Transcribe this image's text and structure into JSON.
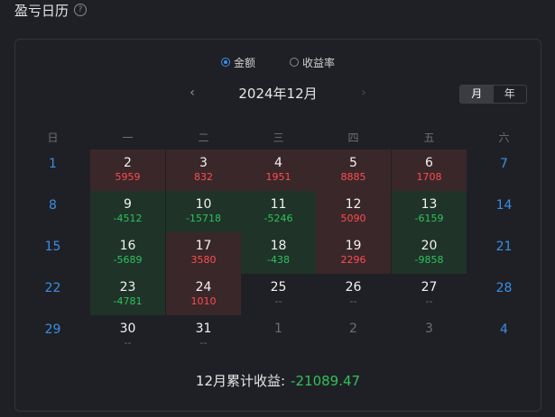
{
  "header": {
    "title": "盈亏日历",
    "help": "?"
  },
  "radio": [
    {
      "label": "金额",
      "selected": true
    },
    {
      "label": "收益率",
      "selected": false
    }
  ],
  "nav": {
    "prev": "‹",
    "month": "2024年12月",
    "next": "›"
  },
  "toggle": {
    "month": "月",
    "year": "年",
    "active": "月"
  },
  "weekdays": [
    "日",
    "一",
    "二",
    "三",
    "四",
    "五",
    "六"
  ],
  "colors": {
    "profit": "#ff4d4d",
    "loss": "#2fc15a",
    "weekend": "#3a8ee6"
  },
  "weeks": [
    [
      {
        "day": "1",
        "value": null,
        "kind": "weekend"
      },
      {
        "day": "2",
        "value": "5959",
        "kind": "pos"
      },
      {
        "day": "3",
        "value": "832",
        "kind": "pos"
      },
      {
        "day": "4",
        "value": "1951",
        "kind": "pos"
      },
      {
        "day": "5",
        "value": "8885",
        "kind": "pos"
      },
      {
        "day": "6",
        "value": "1708",
        "kind": "pos"
      },
      {
        "day": "7",
        "value": null,
        "kind": "weekend"
      }
    ],
    [
      {
        "day": "8",
        "value": null,
        "kind": "weekend"
      },
      {
        "day": "9",
        "value": "-4512",
        "kind": "neg"
      },
      {
        "day": "10",
        "value": "-15718",
        "kind": "neg"
      },
      {
        "day": "11",
        "value": "-5246",
        "kind": "neg"
      },
      {
        "day": "12",
        "value": "5090",
        "kind": "pos"
      },
      {
        "day": "13",
        "value": "-6159",
        "kind": "neg"
      },
      {
        "day": "14",
        "value": null,
        "kind": "weekend"
      }
    ],
    [
      {
        "day": "15",
        "value": null,
        "kind": "weekend"
      },
      {
        "day": "16",
        "value": "-5689",
        "kind": "neg"
      },
      {
        "day": "17",
        "value": "3580",
        "kind": "pos"
      },
      {
        "day": "18",
        "value": "-438",
        "kind": "neg"
      },
      {
        "day": "19",
        "value": "2296",
        "kind": "pos"
      },
      {
        "day": "20",
        "value": "-9858",
        "kind": "neg"
      },
      {
        "day": "21",
        "value": null,
        "kind": "weekend"
      }
    ],
    [
      {
        "day": "22",
        "value": null,
        "kind": "weekend"
      },
      {
        "day": "23",
        "value": "-4781",
        "kind": "neg"
      },
      {
        "day": "24",
        "value": "1010",
        "kind": "pos"
      },
      {
        "day": "25",
        "value": "--",
        "kind": "none"
      },
      {
        "day": "26",
        "value": "--",
        "kind": "none"
      },
      {
        "day": "27",
        "value": "--",
        "kind": "none"
      },
      {
        "day": "28",
        "value": null,
        "kind": "weekend"
      }
    ],
    [
      {
        "day": "29",
        "value": null,
        "kind": "weekend"
      },
      {
        "day": "30",
        "value": "--",
        "kind": "none"
      },
      {
        "day": "31",
        "value": "--",
        "kind": "none"
      },
      {
        "day": "1",
        "value": null,
        "kind": "other"
      },
      {
        "day": "2",
        "value": null,
        "kind": "other"
      },
      {
        "day": "3",
        "value": null,
        "kind": "other"
      },
      {
        "day": "4",
        "value": null,
        "kind": "weekend"
      }
    ]
  ],
  "summary": {
    "label": "12月累计收益:",
    "value": "-21089.47"
  }
}
